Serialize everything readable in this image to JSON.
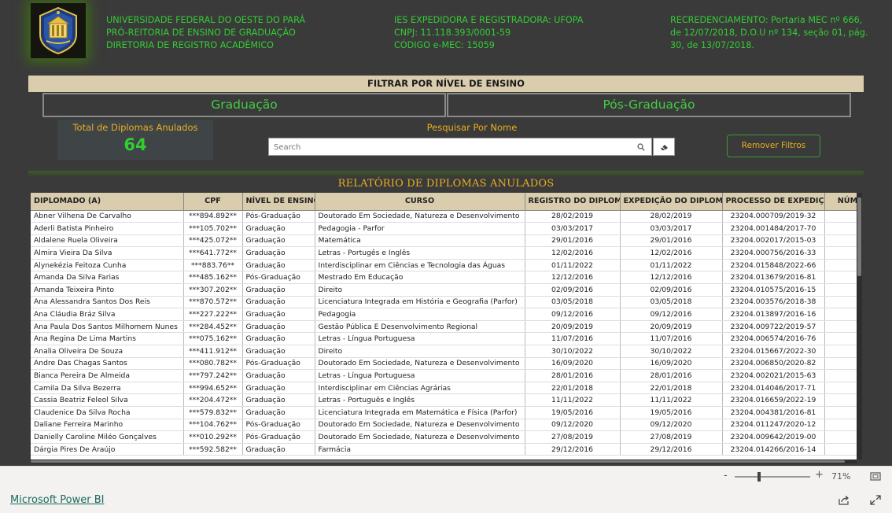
{
  "header": {
    "university": [
      "UNIVERSIDADE FEDERAL DO OESTE DO PARÁ",
      "PRÓ-REITORIA DE ENSINO DE GRADUAÇÃO",
      "DIRETORIA DE REGISTRO ACADÊMICO"
    ],
    "institution": [
      "IES EXPEDIDORA E REGISTRADORA: UFOPA",
      "CNPJ: 11.118.393/0001-59",
      "CÓDIGO e-MEC: 15059"
    ],
    "accreditation": [
      "RECREDENCIAMENTO: Portaria MEC nº 666,",
      "de 12/07/2018, D.O.U nº 134, seção 01, pág.",
      "30, de 13/07/2018."
    ]
  },
  "filter": {
    "title": "FILTRAR POR NÍVEL DE ENSINO",
    "levels": [
      "Graduação",
      "Pós-Graduação"
    ]
  },
  "kpi": {
    "label": "Total de Diplomas Anulados",
    "value": "64"
  },
  "search": {
    "label": "Pesquisar Por Nome",
    "placeholder": "Search",
    "value": ""
  },
  "remove_filters_label": "Remover Filtros",
  "report": {
    "title": "RELATÓRIO DE DIPLOMAS ANULADOS",
    "columns": [
      "DIPLOMADO (A)",
      "CPF",
      "NÍVEL DE ENSINO",
      "CURSO",
      "REGISTRO DO DIPLOMA",
      "EXPEDIÇÃO DO DIPLOMA",
      "PROCESSO DE EXPEDIÇÃO",
      "NÚMERO"
    ],
    "rows": [
      [
        "Abner Vilhena De Carvalho",
        "***894.892**",
        "Pós-Graduação",
        "Doutorado Em Sociedade, Natureza e Desenvolvimento",
        "28/02/2019",
        "28/02/2019",
        "23204.000709/2019-32",
        ""
      ],
      [
        "Aderli Batista Pinheiro",
        "***105.702**",
        "Graduação",
        "Pedagogia - Parfor",
        "03/03/2017",
        "03/03/2017",
        "23204.001484/2017-70",
        ""
      ],
      [
        "Aldalene Ruela Oliveira",
        "***425.072**",
        "Graduação",
        "Matemática",
        "29/01/2016",
        "29/01/2016",
        "23204.002017/2015-03",
        ""
      ],
      [
        "Almira Vieira Da Silva",
        "***641.772**",
        "Graduação",
        "Letras - Portugês e Inglês",
        "12/02/2016",
        "12/02/2016",
        "23204.000756/2016-33",
        ""
      ],
      [
        "Alynekézia Feitoza Cunha",
        "***883.76**",
        "Graduação",
        "Interdisciplinar em Ciências e Tecnologia das Águas",
        "01/11/2022",
        "01/11/2022",
        "23204.015848/2022-66",
        ""
      ],
      [
        "Amanda Da Silva Farias",
        "***485.162**",
        "Pós-Graduação",
        "Mestrado Em Educação",
        "12/12/2016",
        "12/12/2016",
        "23204.013679/2016-81",
        ""
      ],
      [
        "Amanda Teixeira Pinto",
        "***307.202**",
        "Graduação",
        "Direito",
        "02/09/2016",
        "02/09/2016",
        "23204.010575/2016-15",
        ""
      ],
      [
        "Ana Alessandra Santos Dos Reis",
        "***870.572**",
        "Graduação",
        "Licenciatura Integrada em História e Geografia (Parfor)",
        "03/05/2018",
        "03/05/2018",
        "23204.003576/2018-38",
        ""
      ],
      [
        "Ana Cláudia Bráz Silva",
        "***227.222**",
        "Graduação",
        "Pedagogia",
        "09/12/2016",
        "09/12/2016",
        "23204.013897/2016-16",
        ""
      ],
      [
        "Ana Paula Dos Santos Milhomem Nunes",
        "***284.452**",
        "Graduação",
        "Gestão Pública E Desenvolvimento Regional",
        "20/09/2019",
        "20/09/2019",
        "23204.009722/2019-57",
        ""
      ],
      [
        "Ana Regina De Lima Martins",
        "***075.162**",
        "Graduação",
        "Letras - Língua Portuguesa",
        "11/07/2016",
        "11/07/2016",
        "23204.006574/2016-76",
        ""
      ],
      [
        "Analia Oliveira De Souza",
        "***411.912**",
        "Graduação",
        "Direito",
        "30/10/2022",
        "30/10/2022",
        "23204.015667/2022-30",
        ""
      ],
      [
        "Andre Das Chagas Santos",
        "***080.782**",
        "Pós-Graduação",
        "Doutorado Em Sociedade, Natureza e Desenvolvimento",
        "16/09/2020",
        "16/09/2020",
        "23204.006850/2020-82",
        ""
      ],
      [
        "Bianca Pereira De Almeida",
        "***797.242**",
        "Graduação",
        "Letras - Língua Portuguesa",
        "28/01/2016",
        "28/01/2016",
        "23204.002021/2015-63",
        ""
      ],
      [
        "Camila Da Silva Bezerra",
        "***994.652**",
        "Graduação",
        "Interdisciplinar em Ciências Agrárias",
        "22/01/2018",
        "22/01/2018",
        "23204.014046/2017-71",
        ""
      ],
      [
        "Cassia Beatriz Feleol Silva",
        "***204.472**",
        "Graduação",
        "Letras - Português e Inglês",
        "11/11/2022",
        "11/11/2022",
        "23204.016659/2022-19",
        ""
      ],
      [
        "Claudenice Da Silva Rocha",
        "***579.832**",
        "Graduação",
        "Licenciatura Integrada em Matemática e Física (Parfor)",
        "19/05/2016",
        "19/05/2016",
        "23204.004381/2016-81",
        ""
      ],
      [
        "Daliane Ferreira Marinho",
        "***104.762**",
        "Pós-Graduação",
        "Doutorado Em Sociedade, Natureza e Desenvolvimento",
        "09/12/2020",
        "09/12/2020",
        "23204.011247/2020-12",
        ""
      ],
      [
        "Danielly Caroline Miléo Gonçalves",
        "***010.292**",
        "Pós-Graduação",
        "Doutorado Em Sociedade, Natureza e Desenvolvimento",
        "27/08/2019",
        "27/08/2019",
        "23204.009642/2019-00",
        ""
      ],
      [
        "Dárgia Pires De Araújo",
        "***592.582**",
        "Graduação",
        "Farmácia",
        "29/12/2016",
        "29/12/2016",
        "23204.014266/2016-14",
        ""
      ]
    ]
  },
  "footer": {
    "zoom_minus": "-",
    "zoom_plus": "+",
    "zoom_level": "71%",
    "powerbi_link": "Microsoft Power BI"
  },
  "colors": {
    "background": "#3a3a3a",
    "accent_green": "#33cc33",
    "accent_gold": "#e8b020",
    "header_beige": "#d9cdae"
  },
  "icons": {
    "logo": "ufopa-crest-icon",
    "search": "search-icon",
    "eraser": "eraser-icon",
    "fit": "fit-to-page-icon",
    "share": "share-icon",
    "expand": "expand-icon"
  }
}
